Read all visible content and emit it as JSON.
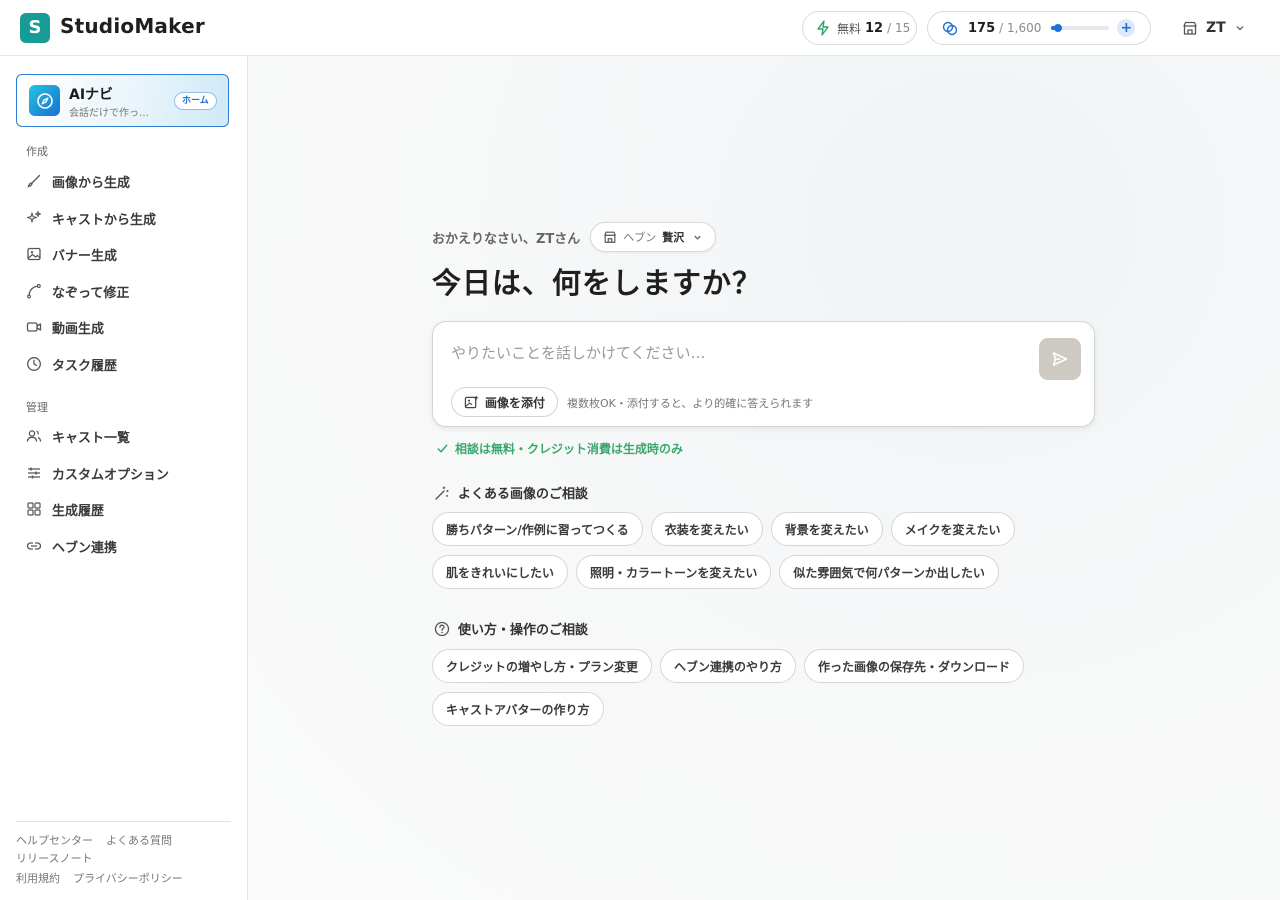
{
  "brand": {
    "logo_letter": "S",
    "name": "StudioMaker",
    "accent": "#179b97"
  },
  "header": {
    "free": {
      "icon": "lightning-icon",
      "label": "無料",
      "used": "12",
      "total": "/ 15"
    },
    "credits": {
      "icon": "coin-icon",
      "value": "175",
      "total": "/ 1,600",
      "progress": 0.11,
      "plus": "+"
    },
    "user": {
      "icon": "store-icon",
      "name": "ZT"
    }
  },
  "sidebar": {
    "ai_card": {
      "title": "AIナビ",
      "subtitle": "会話だけで作っ…",
      "badge": "ホーム"
    },
    "section_create": "作成",
    "create_items": [
      {
        "label": "画像から生成",
        "icon": "brush-icon"
      },
      {
        "label": "キャストから生成",
        "icon": "sparkles-icon"
      },
      {
        "label": "バナー生成",
        "icon": "image-icon"
      },
      {
        "label": "なぞって修正",
        "icon": "path-icon"
      },
      {
        "label": "動画生成",
        "icon": "video-icon"
      },
      {
        "label": "タスク履歴",
        "icon": "clock-icon"
      }
    ],
    "section_manage": "管理",
    "manage_items": [
      {
        "label": "キャスト一覧",
        "icon": "users-icon"
      },
      {
        "label": "カスタムオプション",
        "icon": "sliders-icon"
      },
      {
        "label": "生成履歴",
        "icon": "grid-icon"
      },
      {
        "label": "ヘブン連携",
        "icon": "link-icon"
      }
    ],
    "footer": {
      "help": "ヘルプセンター",
      "faq": "よくある質問",
      "release": "リリースノート",
      "terms": "利用規約",
      "privacy": "プライバシーポリシー"
    }
  },
  "main": {
    "greeting": "おかえりなさい、ZTさん",
    "store": {
      "prefix": "ヘブン",
      "name": "贅沢"
    },
    "headline": "今日は、何をしますか？",
    "composer": {
      "placeholder": "やりたいことを話しかけてください…",
      "attach_label": "画像を添付",
      "hint": "複数枚OK・添付すると、より的確に答えられます"
    },
    "free_note": "相談は無料・クレジット消費は生成時のみ",
    "image_block": {
      "title": "よくある画像のご相談",
      "row1": [
        "勝ちパターン/作例に習ってつくる",
        "衣装を変えたい",
        "背景を変えたい",
        "メイクを変えたい"
      ],
      "row2": [
        "肌をきれいにしたい",
        "照明・カラートーンを変えたい",
        "似た雰囲気で何パターンか出したい"
      ]
    },
    "usage_block": {
      "title": "使い方・操作のご相談",
      "row1": [
        "クレジットの増やし方・プラン変更",
        "ヘブン連携のやり方",
        "作った画像の保存先・ダウンロード"
      ],
      "row2": [
        "キャストアバターの作り方"
      ]
    }
  }
}
